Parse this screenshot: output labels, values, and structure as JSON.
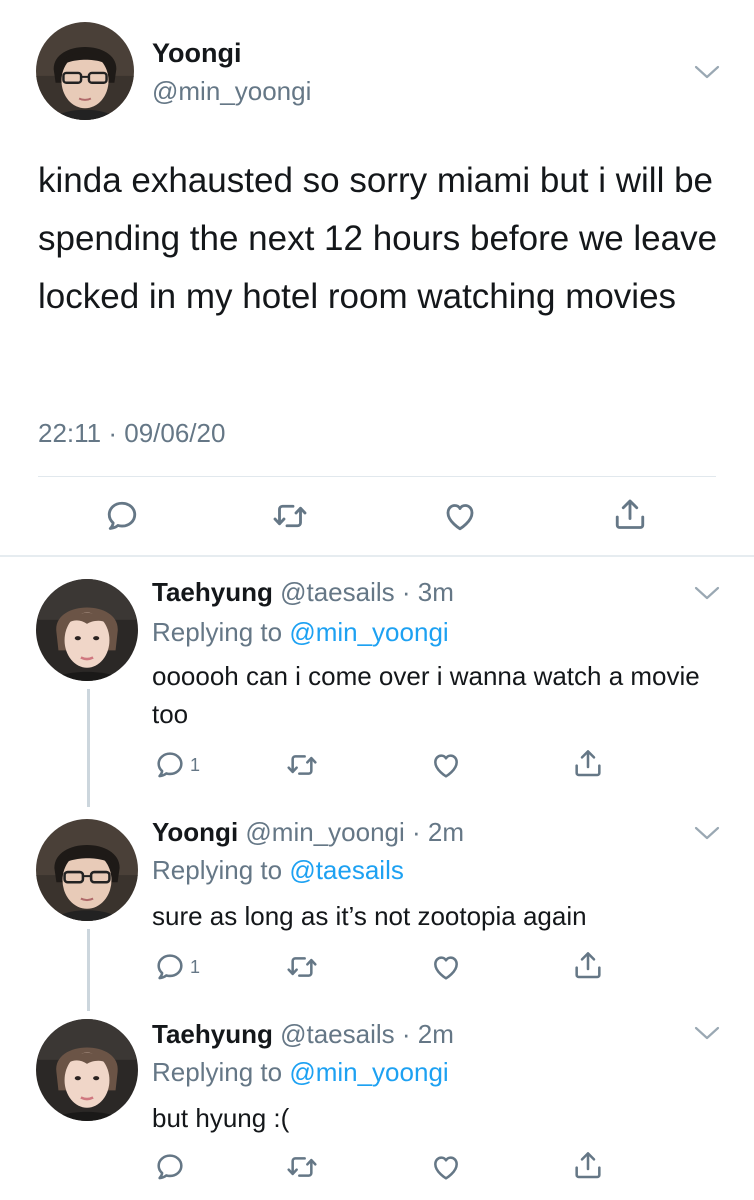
{
  "main_tweet": {
    "name": "Yoongi",
    "handle": "@min_yoongi",
    "text": "kinda exhausted so sorry miami but i will be spending the next 12 hours before we leave locked in my hotel room watching movies",
    "timestamp": "22:11 · 09/06/20",
    "actions": [
      "reply-icon",
      "retweet-icon",
      "like-icon",
      "share-icon"
    ]
  },
  "replies": [
    {
      "name": "Taehyung",
      "handle": "@taesails",
      "time": "· 3m",
      "replying_label": "Replying to",
      "replying_to": "@min_yoongi",
      "text": "oooooh can i come over i wanna watch a movie too",
      "reply_count": "1"
    },
    {
      "name": "Yoongi",
      "handle": "@min_yoongi",
      "time": "· 2m",
      "replying_label": "Replying to",
      "replying_to": "@taesails",
      "text": "sure as long as it’s not zootopia again",
      "reply_count": "1"
    },
    {
      "name": "Taehyung",
      "handle": "@taesails",
      "time": "· 2m",
      "replying_label": "Replying to",
      "replying_to": "@min_yoongi",
      "text": "but hyung :(",
      "reply_count": ""
    }
  ],
  "colors": {
    "text": "#14171a",
    "secondary": "#657786",
    "link": "#1da1f2",
    "divider": "#e1e8ed",
    "thread_line": "#ccd6dd"
  }
}
